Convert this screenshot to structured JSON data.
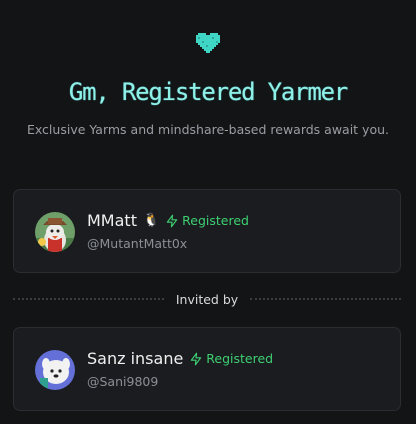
{
  "header": {
    "title": "Gm, Registered Yarmer",
    "subtitle": "Exclusive Yarms and mindshare-based rewards await you.",
    "heart_color": "#3fd6c6"
  },
  "divider": {
    "label": "Invited by"
  },
  "accent_colors": {
    "registered": "#3ecf72",
    "title": "#8ff0e8"
  },
  "user_card": {
    "name": "MMatt",
    "emoji": "🐧",
    "badge": "Registered",
    "handle": "@MutantMatt0x",
    "badge_icon": "lightning-icon"
  },
  "inviter_card": {
    "name": "Sanz insane",
    "badge": "Registered",
    "handle": "@Sani9809",
    "badge_icon": "lightning-icon"
  }
}
